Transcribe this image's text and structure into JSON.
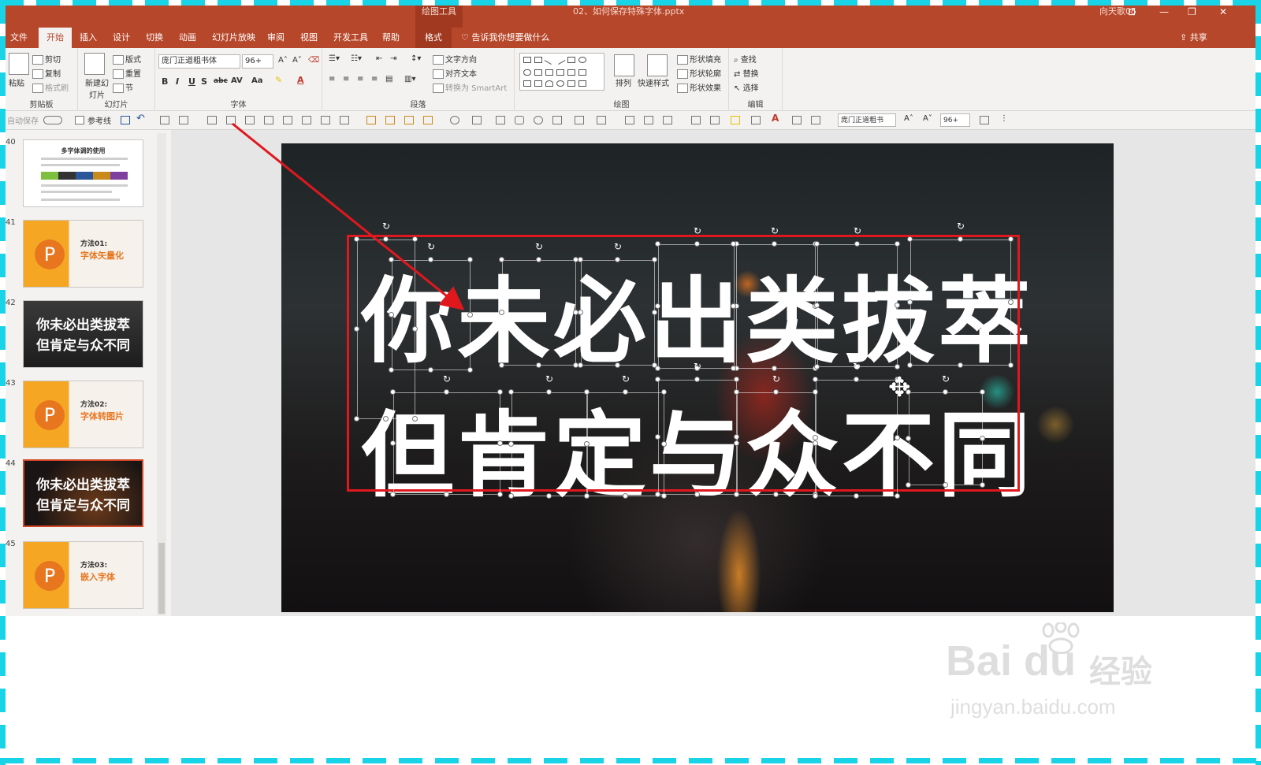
{
  "titlebar": {
    "context_tool": "绘图工具",
    "document": "02、如何保存特殊字体.pptx",
    "user": "向天歌05"
  },
  "tabs": [
    "文件",
    "开始",
    "插入",
    "设计",
    "切换",
    "动画",
    "幻灯片放映",
    "审阅",
    "视图",
    "开发工具",
    "帮助",
    "格式"
  ],
  "tell_me": "告诉我你想要做什么",
  "share": "共享",
  "ribbon": {
    "clipboard": {
      "paste": "粘贴",
      "cut": "剪切",
      "copy": "复制",
      "format_painter": "格式刷",
      "label": "剪贴板"
    },
    "slides": {
      "new_slide": "新建幻灯片",
      "layout": "版式",
      "reset": "重置",
      "section": "节",
      "label": "幻灯片"
    },
    "font": {
      "font_name": "庞门正道粗书体",
      "font_size": "96+",
      "label": "字体"
    },
    "paragraph": {
      "text_direction": "文字方向",
      "align_text": "对齐文本",
      "smartart": "转换为 SmartArt",
      "label": "段落"
    },
    "drawing": {
      "arrange": "排列",
      "quick_styles": "快速样式",
      "shape_fill": "形状填充",
      "shape_outline": "形状轮廓",
      "shape_effects": "形状效果",
      "label": "绘图"
    },
    "editing": {
      "find": "查找",
      "replace": "替换",
      "select": "选择",
      "label": "编辑"
    }
  },
  "qat": {
    "autosave": "自动保存",
    "guides": "参考线",
    "font_name": "庞门正道粗书",
    "font_size": "96+"
  },
  "thumbnails": [
    {
      "num": "40",
      "type": "white",
      "title": "多字体调的使用"
    },
    {
      "num": "41",
      "type": "orange",
      "t1": "方法01:",
      "t2": "字体矢量化"
    },
    {
      "num": "42",
      "type": "dark",
      "line1": "你未必出类拔萃",
      "line2": "但肯定与众不同"
    },
    {
      "num": "43",
      "type": "orange",
      "t1": "方法02:",
      "t2": "字体转图片"
    },
    {
      "num": "44",
      "type": "dark2",
      "line1": "你未必出类拔萃",
      "line2": "但肯定与众不同",
      "selected": true
    },
    {
      "num": "45",
      "type": "orange",
      "t1": "方法03:",
      "t2": "嵌入字体"
    }
  ],
  "slide": {
    "line1": "你未必出类拔萃",
    "line2": "但肯定与众不同"
  },
  "watermark": {
    "brand": "Bai du",
    "cn": "经验",
    "url": "jingyan.baidu.com"
  },
  "colors": {
    "accent": "#b7472a",
    "highlight": "#e0181e",
    "frame": "#19d3e6"
  }
}
